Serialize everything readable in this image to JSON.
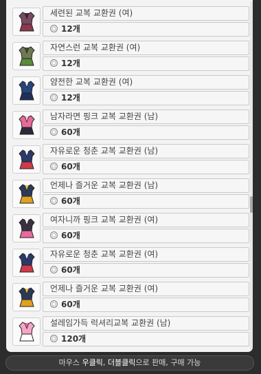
{
  "items": [
    {
      "name": "세련된 교복 교환권 (여)",
      "price": "12개",
      "colors": [
        "#7a4a63",
        "#3a2a3a",
        "#8a3a4a"
      ]
    },
    {
      "name": "자연스런 교복 교환권 (여)",
      "price": "12개",
      "colors": [
        "#6e7a52",
        "#46493a",
        "#5a8a3a"
      ]
    },
    {
      "name": "얌전한 교복 교환권 (여)",
      "price": "12개",
      "colors": [
        "#27457a",
        "#e8e8f0",
        "#1e2f5a"
      ]
    },
    {
      "name": "남자라면 핑크 교복 교환권 (남)",
      "price": "60개",
      "colors": [
        "#e86a9a",
        "#f3c0d6",
        "#2a2a3a"
      ]
    },
    {
      "name": "자유로운 청춘 교복 교환권 (남)",
      "price": "60개",
      "colors": [
        "#2a3a6a",
        "#f0f0f0",
        "#d03a4a"
      ]
    },
    {
      "name": "언제나 즐거운 교복 교환권 (남)",
      "price": "60개",
      "colors": [
        "#2c3a5a",
        "#f0c040",
        "#e0a020"
      ]
    },
    {
      "name": "여자니까 핑크 교복 교환권 (여)",
      "price": "60개",
      "colors": [
        "#3a3040",
        "#f0f0f0",
        "#e86aa0"
      ]
    },
    {
      "name": "자유로운 청춘 교복 교환권 (여)",
      "price": "60개",
      "colors": [
        "#2a3a6a",
        "#f0f0f0",
        "#d03a4a"
      ]
    },
    {
      "name": "언제나 즐거운 교복 교환권 (여)",
      "price": "60개",
      "colors": [
        "#2c3a5a",
        "#f0c040",
        "#e0a020"
      ]
    },
    {
      "name": "설레임가득 럭셔리교복 교환권 (남)",
      "price": "120개",
      "colors": [
        "#f4a6c6",
        "#e86a9a",
        "#ffffff"
      ]
    }
  ],
  "hint": {
    "prefix": "마우스 ",
    "right_click": "우클릭",
    "sep": ", ",
    "double_click": "더블클릭",
    "suffix": "으로 판매, 구매 가능"
  },
  "icons": {
    "price": "coin-icon",
    "thumb": "outfit-icon"
  }
}
